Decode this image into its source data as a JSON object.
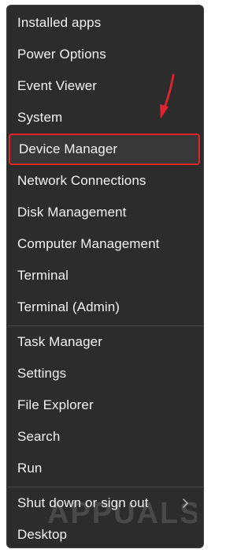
{
  "menu": {
    "items": [
      {
        "label": "Installed apps"
      },
      {
        "label": "Power Options"
      },
      {
        "label": "Event Viewer"
      },
      {
        "label": "System"
      },
      {
        "label": "Device Manager"
      },
      {
        "label": "Network Connections"
      },
      {
        "label": "Disk Management"
      },
      {
        "label": "Computer Management"
      },
      {
        "label": "Terminal"
      },
      {
        "label": "Terminal (Admin)"
      },
      {
        "label": "Task Manager"
      },
      {
        "label": "Settings"
      },
      {
        "label": "File Explorer"
      },
      {
        "label": "Search"
      },
      {
        "label": "Run"
      },
      {
        "label": "Shut down or sign out"
      },
      {
        "label": "Desktop"
      }
    ],
    "highlighted_label": "Device Manager",
    "submenu_icon": "chevron-right-icon"
  },
  "annotation": {
    "arrow_color": "#e0242c",
    "highlight_color": "#e0242c"
  },
  "watermark": {
    "text": "APPUALS"
  },
  "colors": {
    "menu_background": "#2c2c2c",
    "menu_text": "#f2f2f2",
    "separator": "#474747"
  }
}
